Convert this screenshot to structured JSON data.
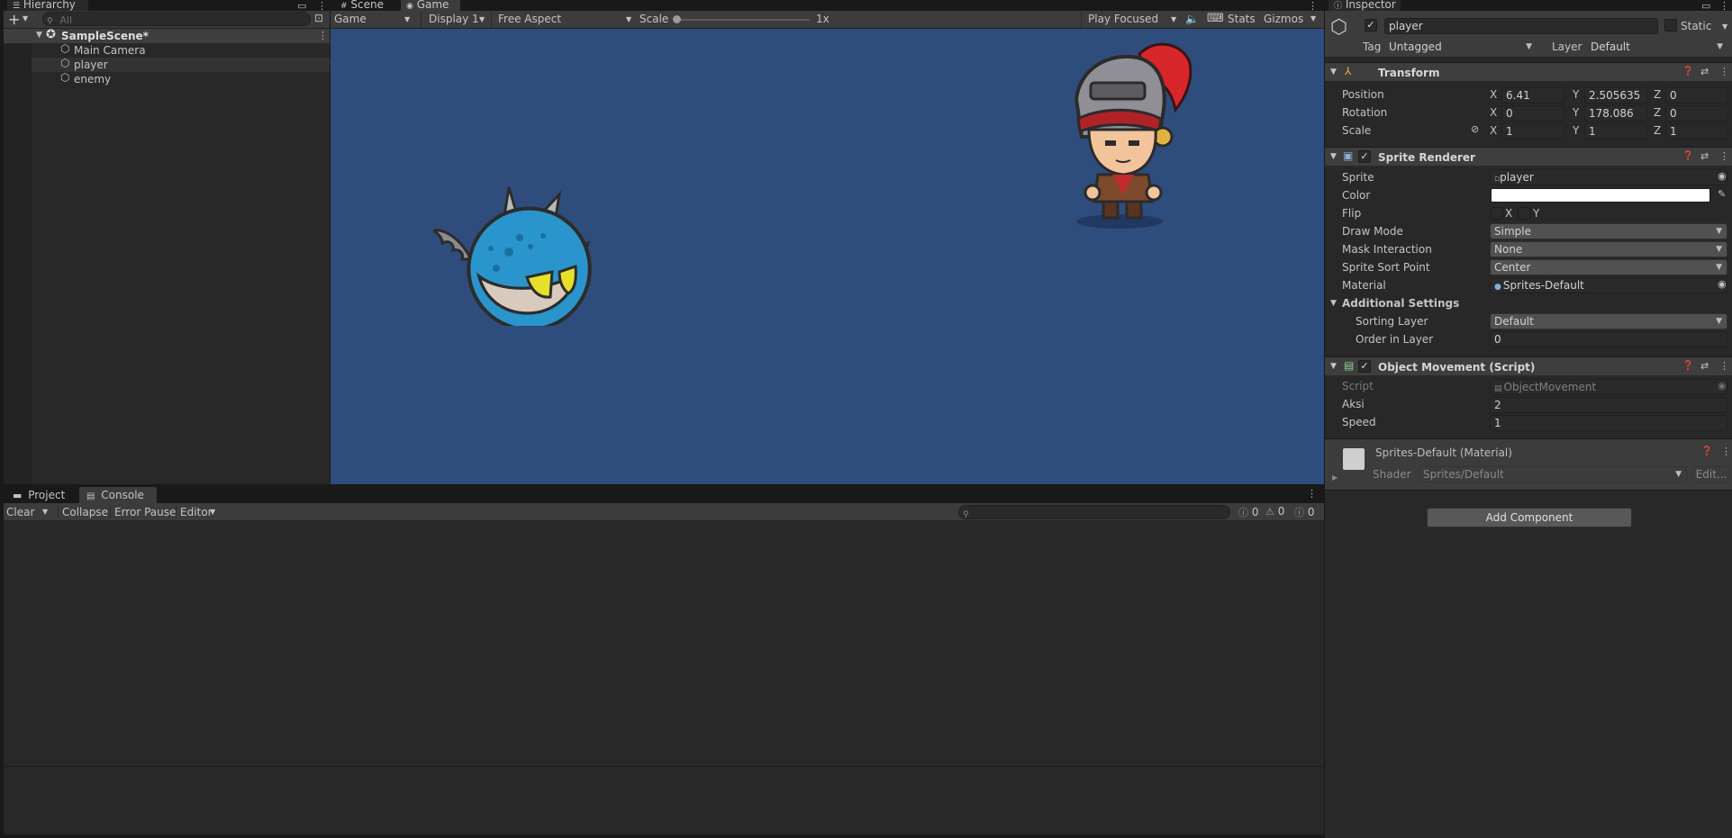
{
  "hierarchy": {
    "tab": "Hierarchy",
    "search_placeholder": "All",
    "scene": "SampleScene*",
    "items": [
      "Main Camera",
      "player",
      "enemy"
    ]
  },
  "view": {
    "tabs": [
      "Scene",
      "Game"
    ],
    "mode": "Game",
    "display": "Display 1",
    "aspect": "Free Aspect",
    "scale_label": "Scale",
    "scale_value": "1x",
    "play_mode": "Play Focused",
    "stats": "Stats",
    "gizmos": "Gizmos",
    "background": "#2f4d7c"
  },
  "console": {
    "tabs": [
      "Project",
      "Console"
    ],
    "clear": "Clear",
    "collapse": "Collapse",
    "error_pause": "Error Pause",
    "editor": "Editor",
    "count_errors": "0",
    "count_warnings": "0",
    "count_info": "0"
  },
  "inspector": {
    "tab": "Inspector",
    "object_name": "player",
    "static_label": "Static",
    "tag_label": "Tag",
    "tag": "Untagged",
    "layer_label": "Layer",
    "layer": "Default",
    "transform": {
      "title": "Transform",
      "position_label": "Position",
      "rotation_label": "Rotation",
      "scale_label": "Scale",
      "position": {
        "x": "6.41",
        "y": "2.505635",
        "z": "0"
      },
      "rotation": {
        "x": "0",
        "y": "178.086",
        "z": "0"
      },
      "scale": {
        "x": "1",
        "y": "1",
        "z": "1"
      }
    },
    "sprite_renderer": {
      "title": "Sprite Renderer",
      "sprite_label": "Sprite",
      "sprite": "player",
      "color_label": "Color",
      "color": "#ffffff",
      "flip_label": "Flip",
      "flip_x": "X",
      "flip_y": "Y",
      "draw_mode_label": "Draw Mode",
      "draw_mode": "Simple",
      "mask_label": "Mask Interaction",
      "mask": "None",
      "sort_point_label": "Sprite Sort Point",
      "sort_point": "Center",
      "material_label": "Material",
      "material": "Sprites-Default",
      "additional": "Additional Settings",
      "sorting_layer_label": "Sorting Layer",
      "sorting_layer": "Default",
      "order_label": "Order in Layer",
      "order": "0"
    },
    "movement": {
      "title": "Object Movement (Script)",
      "script_label": "Script",
      "script": "ObjectMovement",
      "aksi_label": "Aksi",
      "aksi": "2",
      "speed_label": "Speed",
      "speed": "1"
    },
    "material": {
      "title": "Sprites-Default (Material)",
      "shader_label": "Shader",
      "shader": "Sprites/Default",
      "edit": "Edit..."
    },
    "add_component": "Add Component"
  }
}
